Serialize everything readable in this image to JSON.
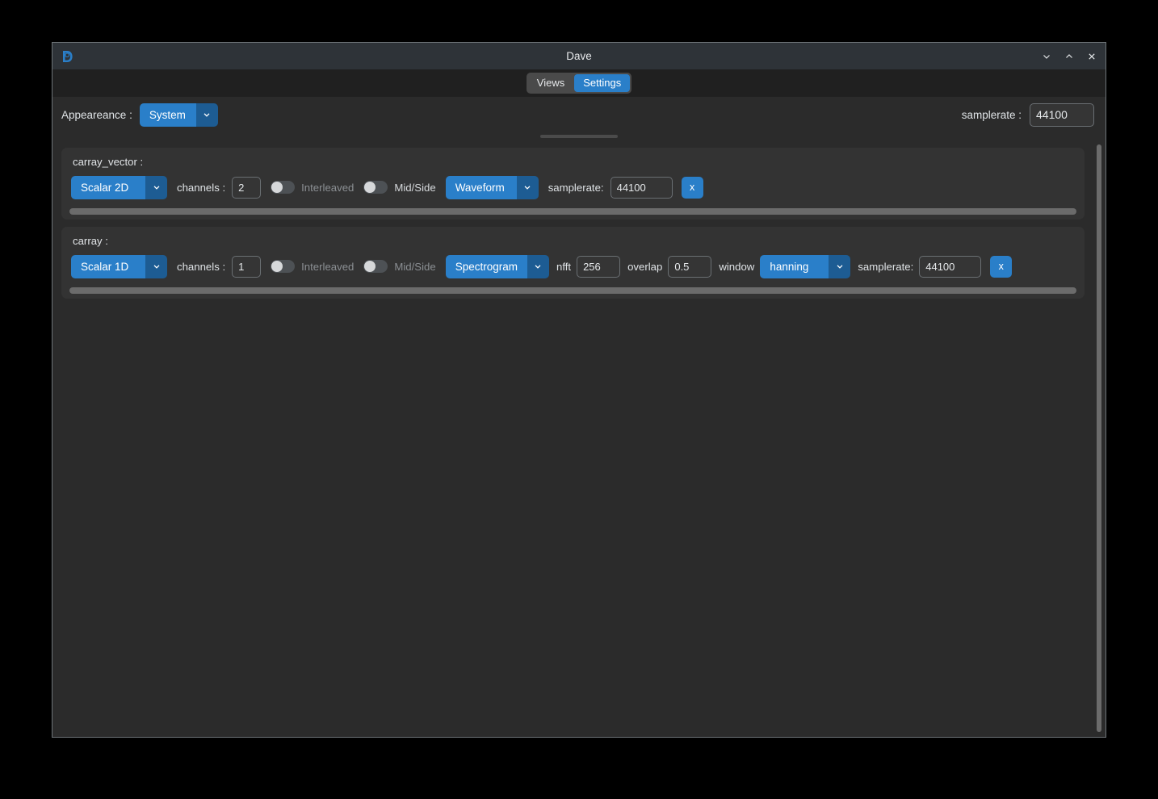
{
  "window": {
    "title": "Dave",
    "logo_icon": "dave-d-logo",
    "controls": [
      {
        "name": "minimize",
        "icon": "chevron-down-icon",
        "glyph": "∨"
      },
      {
        "name": "maximize",
        "icon": "chevron-up-icon",
        "glyph": "∧"
      },
      {
        "name": "close",
        "icon": "close-icon",
        "glyph": "✕"
      }
    ]
  },
  "tabs": [
    {
      "label": "Views",
      "active": false
    },
    {
      "label": "Settings",
      "active": true
    }
  ],
  "header": {
    "appearance_label": "Appeareance :",
    "appearance_value": "System",
    "samplerate_label": "samplerate :",
    "samplerate_value": "44100",
    "samplerate_placeholder": "44100"
  },
  "panels": [
    {
      "title": "carray_vector :",
      "type_value": "Scalar 2D",
      "channels_label": "channels :",
      "channels_value": "2",
      "interleaved_label": "Interleaved",
      "interleaved_on": false,
      "interleaved_dim": true,
      "midside_label": "Mid/Side",
      "midside_on": false,
      "midside_dim": false,
      "view_value": "Waveform",
      "samplerate_label": "samplerate:",
      "samplerate_value": "44100",
      "close_label": "x",
      "has_fft": false
    },
    {
      "title": "carray :",
      "type_value": "Scalar 1D",
      "channels_label": "channels :",
      "channels_value": "1",
      "interleaved_label": "Interleaved",
      "interleaved_on": false,
      "interleaved_dim": true,
      "midside_label": "Mid/Side",
      "midside_on": false,
      "midside_dim": true,
      "view_value": "Spectrogram",
      "nfft_label": "nfft",
      "nfft_value": "256",
      "overlap_label": "overlap",
      "overlap_value": "0.5",
      "window_label": "window",
      "window_value": "hanning",
      "samplerate_label": "samplerate:",
      "samplerate_value": "44100",
      "close_label": "x",
      "has_fft": true
    }
  ],
  "colors": {
    "accent": "#2a7fc9",
    "accent_dark": "#1d5c93",
    "window_bg": "#2b2b2b",
    "panel_bg": "#333333",
    "titlebar_bg": "#2e3338",
    "tabbar_bg": "#202020",
    "text": "#e2e5e8",
    "text_dim": "#8b8f93",
    "scrollbar": "#6b6b6b"
  }
}
